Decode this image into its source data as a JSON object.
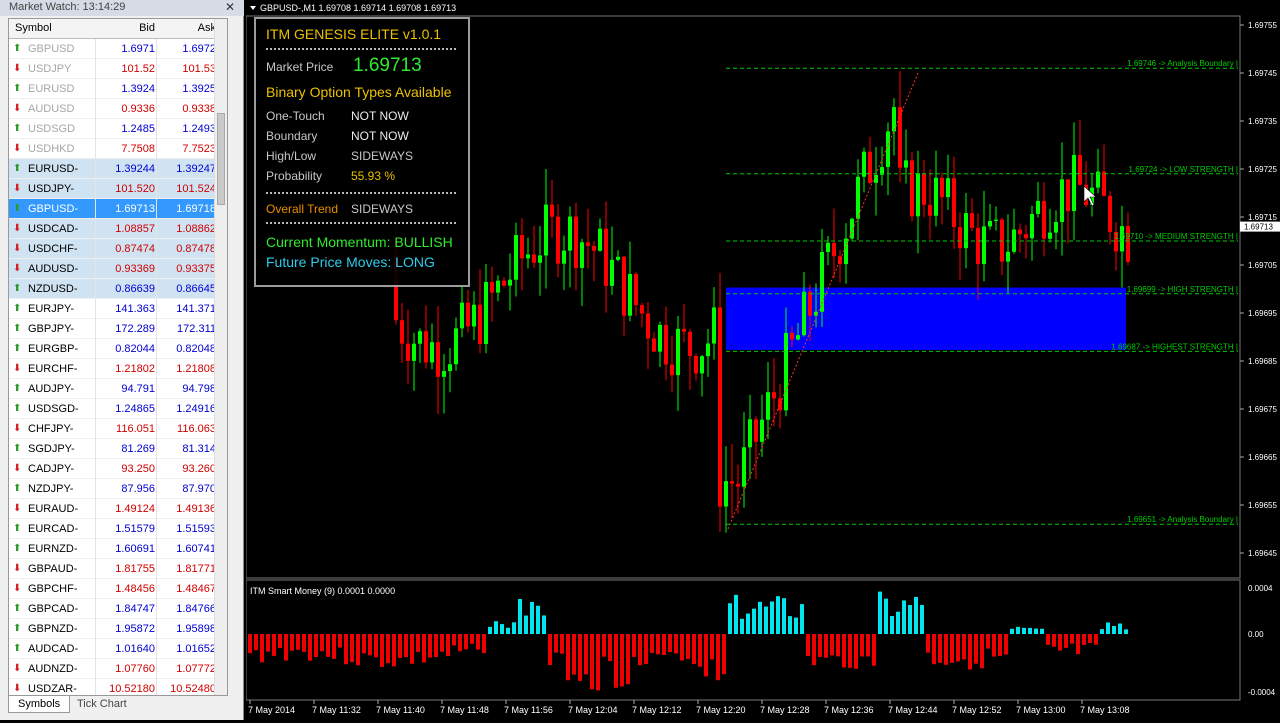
{
  "market_watch": {
    "title": "Market Watch: 13:14:29",
    "columns": {
      "symbol": "Symbol",
      "bid": "Bid",
      "ask": "Ask"
    },
    "rows": [
      {
        "symbol": "GBPUSD",
        "bid": "1.6971",
        "ask": "1.6972",
        "dir": "up",
        "state": "dis"
      },
      {
        "symbol": "USDJPY",
        "bid": "101.52",
        "ask": "101.53",
        "dir": "dn",
        "state": "dis"
      },
      {
        "symbol": "EURUSD",
        "bid": "1.3924",
        "ask": "1.3925",
        "dir": "up",
        "state": "dis"
      },
      {
        "symbol": "AUDUSD",
        "bid": "0.9336",
        "ask": "0.9338",
        "dir": "dn",
        "state": "dis"
      },
      {
        "symbol": "USDSGD",
        "bid": "1.2485",
        "ask": "1.2493",
        "dir": "up",
        "state": "dis"
      },
      {
        "symbol": "USDHKD",
        "bid": "7.7508",
        "ask": "7.7523",
        "dir": "dn",
        "state": "dis"
      },
      {
        "symbol": "EURUSD-",
        "bid": "1.39244",
        "ask": "1.39247",
        "dir": "up",
        "state": "sel"
      },
      {
        "symbol": "USDJPY-",
        "bid": "101.520",
        "ask": "101.524",
        "dir": "dn",
        "state": "sel"
      },
      {
        "symbol": "GBPUSD-",
        "bid": "1.69713",
        "ask": "1.69718",
        "dir": "up",
        "state": "cur"
      },
      {
        "symbol": "USDCAD-",
        "bid": "1.08857",
        "ask": "1.08862",
        "dir": "dn",
        "state": "sel"
      },
      {
        "symbol": "USDCHF-",
        "bid": "0.87474",
        "ask": "0.87478",
        "dir": "dn",
        "state": "sel"
      },
      {
        "symbol": "AUDUSD-",
        "bid": "0.93369",
        "ask": "0.93375",
        "dir": "dn",
        "state": "sel"
      },
      {
        "symbol": "NZDUSD-",
        "bid": "0.86639",
        "ask": "0.86645",
        "dir": "up",
        "state": "sel"
      },
      {
        "symbol": "EURJPY-",
        "bid": "141.363",
        "ask": "141.371",
        "dir": "up",
        "state": ""
      },
      {
        "symbol": "GBPJPY-",
        "bid": "172.289",
        "ask": "172.311",
        "dir": "up",
        "state": ""
      },
      {
        "symbol": "EURGBP-",
        "bid": "0.82044",
        "ask": "0.82048",
        "dir": "up",
        "state": ""
      },
      {
        "symbol": "EURCHF-",
        "bid": "1.21802",
        "ask": "1.21808",
        "dir": "dn",
        "state": ""
      },
      {
        "symbol": "AUDJPY-",
        "bid": "94.791",
        "ask": "94.798",
        "dir": "up",
        "state": ""
      },
      {
        "symbol": "USDSGD-",
        "bid": "1.24865",
        "ask": "1.24916",
        "dir": "up",
        "state": ""
      },
      {
        "symbol": "CHFJPY-",
        "bid": "116.051",
        "ask": "116.063",
        "dir": "dn",
        "state": ""
      },
      {
        "symbol": "SGDJPY-",
        "bid": "81.269",
        "ask": "81.314",
        "dir": "up",
        "state": ""
      },
      {
        "symbol": "CADJPY-",
        "bid": "93.250",
        "ask": "93.260",
        "dir": "dn",
        "state": ""
      },
      {
        "symbol": "NZDJPY-",
        "bid": "87.956",
        "ask": "87.970",
        "dir": "up",
        "state": ""
      },
      {
        "symbol": "EURAUD-",
        "bid": "1.49124",
        "ask": "1.49136",
        "dir": "dn",
        "state": ""
      },
      {
        "symbol": "EURCAD-",
        "bid": "1.51579",
        "ask": "1.51593",
        "dir": "up",
        "state": ""
      },
      {
        "symbol": "EURNZD-",
        "bid": "1.60691",
        "ask": "1.60741",
        "dir": "up",
        "state": ""
      },
      {
        "symbol": "GBPAUD-",
        "bid": "1.81755",
        "ask": "1.81771",
        "dir": "dn",
        "state": ""
      },
      {
        "symbol": "GBPCHF-",
        "bid": "1.48456",
        "ask": "1.48467",
        "dir": "dn",
        "state": ""
      },
      {
        "symbol": "GBPCAD-",
        "bid": "1.84747",
        "ask": "1.84766",
        "dir": "up",
        "state": ""
      },
      {
        "symbol": "GBPNZD-",
        "bid": "1.95872",
        "ask": "1.95898",
        "dir": "up",
        "state": ""
      },
      {
        "symbol": "AUDCAD-",
        "bid": "1.01640",
        "ask": "1.01652",
        "dir": "up",
        "state": ""
      },
      {
        "symbol": "AUDNZD-",
        "bid": "1.07760",
        "ask": "1.07772",
        "dir": "dn",
        "state": ""
      },
      {
        "symbol": "USDZAR-",
        "bid": "10.52180",
        "ask": "10.52480",
        "dir": "dn",
        "state": ""
      }
    ],
    "tabs": [
      "Symbols",
      "Tick Chart"
    ]
  },
  "chart": {
    "title": "GBPUSD-,M1  1.69708 1.69714 1.69708 1.69713",
    "current_price": "1.69713",
    "price_ticks": [
      "1.69755",
      "1.69745",
      "1.69735",
      "1.69725",
      "1.69715",
      "1.69705",
      "1.69695",
      "1.69685",
      "1.69675",
      "1.69665",
      "1.69655",
      "1.69645"
    ],
    "levels": [
      {
        "price": 1.69746,
        "label": "1.69746 -> Analysis Boundary |"
      },
      {
        "price": 1.69724,
        "label": "1.69724 -> LOW STRENGTH |"
      },
      {
        "price": 1.6971,
        "label": "1.69710 -> MEDIUM STRENGTH |"
      },
      {
        "price": 1.69699,
        "label": "1.69699 -> HIGH STRENGTH |"
      },
      {
        "price": 1.69687,
        "label": "1.69687 -> HIGHEST STRENGTH |"
      },
      {
        "price": 1.69651,
        "label": "1.69651 -> Analysis Boundary |"
      }
    ],
    "time_labels": [
      "7 May 2014",
      "7 May 11:32",
      "7 May 11:40",
      "7 May 11:48",
      "7 May 11:56",
      "7 May 12:04",
      "7 May 12:12",
      "7 May 12:20",
      "7 May 12:28",
      "7 May 12:36",
      "7 May 12:44",
      "7 May 12:52",
      "7 May 13:00",
      "7 May 13:08"
    ],
    "indicator": {
      "title": "ITM Smart Money (9) 0.0001 0.0000",
      "ticks": [
        "0.0004",
        "0.00",
        "-0.0004"
      ]
    }
  },
  "genesis": {
    "title": "ITM GENESIS ELITE v1.0.1",
    "market_price_label": "Market Price",
    "market_price": "1.69713",
    "section": "Binary Option Types Available",
    "rows": [
      {
        "k": "One-Touch",
        "v": "NOT NOW"
      },
      {
        "k": "Boundary",
        "v": "NOT NOW"
      },
      {
        "k": "High/Low",
        "v": "SIDEWAYS"
      },
      {
        "k": "Probability",
        "v": "55.93 %"
      }
    ],
    "trend_label": "Overall Trend",
    "trend_value": "SIDEWAYS",
    "momentum": "Current Momentum: BULLISH",
    "future": "Future Price Moves: LONG",
    "colors": {
      "title": "#ffd200",
      "price": "#33ff33",
      "section": "#ffd200",
      "prob": "#ffd200",
      "trend": "#ff9900",
      "momentum": "#33ff33",
      "future": "#33ddff"
    }
  },
  "colors": {
    "bull": "#00ff00",
    "bear": "#ff0000",
    "zone": "#0000ff",
    "hist_up": "#00e5ee",
    "hist_dn": "#ee0000",
    "level": "#00cc00"
  }
}
